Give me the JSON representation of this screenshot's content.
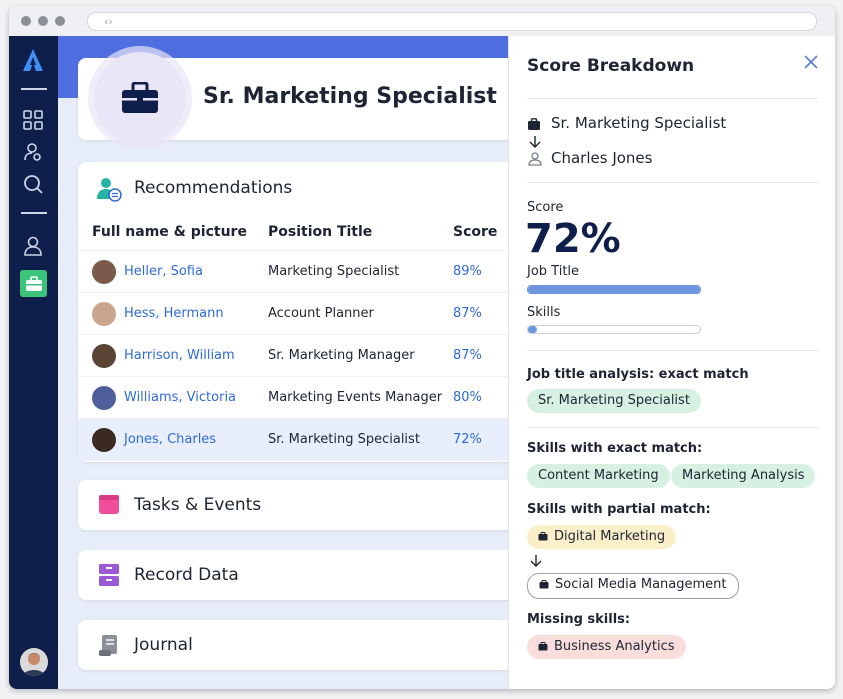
{
  "browser": {
    "nav_glyph": "‹›"
  },
  "nav": {
    "items": [
      "logo",
      "dashboard-icon",
      "people-icon",
      "search-icon",
      "person-icon",
      "briefcase-icon"
    ]
  },
  "header": {
    "title": "Sr. Marketing Specialist"
  },
  "recommendations": {
    "title": "Recommendations",
    "columns": [
      "Full name & picture",
      "Position Title",
      "Score"
    ],
    "rows": [
      {
        "name": "Heller, Sofia",
        "position": "Marketing Specialist",
        "score": "89%"
      },
      {
        "name": "Hess, Hermann",
        "position": "Account Planner",
        "score": "87%"
      },
      {
        "name": "Harrison, William",
        "position": "Sr. Marketing Manager",
        "score": "87%"
      },
      {
        "name": "Williams, Victoria",
        "position": "Marketing Events Manager",
        "score": "80%"
      },
      {
        "name": "Jones, Charles",
        "position": "Sr. Marketing Specialist",
        "score": "72%"
      }
    ]
  },
  "sections": {
    "tasks": "Tasks & Events",
    "records": "Record Data",
    "journal": "Journal"
  },
  "panel": {
    "title": "Score Breakdown",
    "job": "Sr. Marketing Specialist",
    "candidate": "Charles Jones",
    "score_label": "Score",
    "score_value": "72%",
    "job_title_label": "Job Title",
    "job_title_level": 1.0,
    "skills_label": "Skills",
    "skills_level": 0.05,
    "analysis_label": "Job title analysis: exact match",
    "analysis_chip": "Sr. Marketing Specialist",
    "exact_label": "Skills with exact match:",
    "exact_chips": [
      "Content Marketing",
      "Marketing Analysis"
    ],
    "partial_label": "Skills with partial match:",
    "partial_from": "Digital Marketing",
    "partial_to": "Social Media Management",
    "missing_label": "Missing skills:",
    "missing_chip": "Business Analytics"
  },
  "colors": {
    "accent": "#2f6bd6",
    "nav": "#0f1f4b",
    "band": "#4f6fe0",
    "green_chip": "#d6f1e1",
    "yellow_chip": "#fbefc9",
    "pink_chip": "#f9dcdc"
  }
}
